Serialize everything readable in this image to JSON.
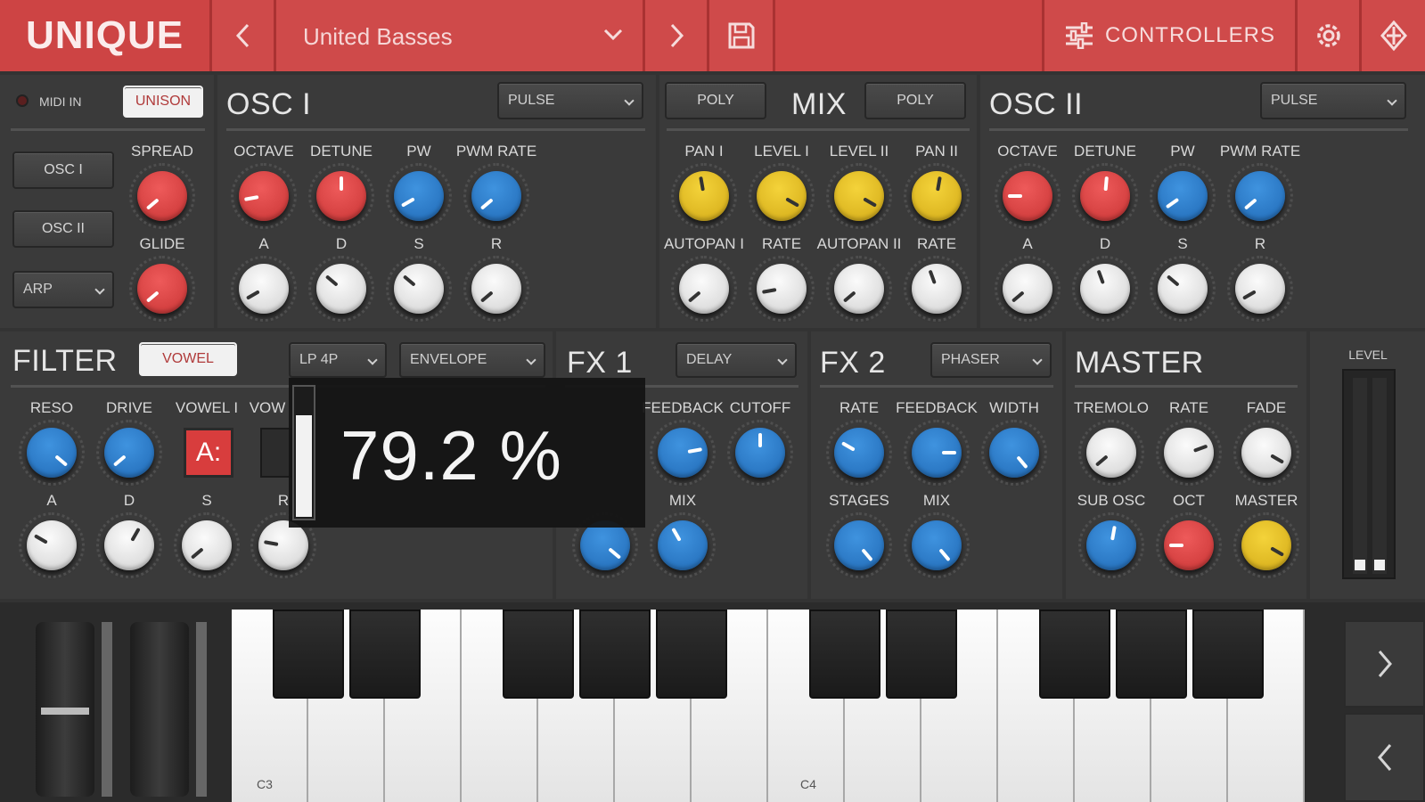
{
  "topbar": {
    "logo": "UNIQUE",
    "preset_name": "United Basses",
    "controllers_label": "CONTROLLERS"
  },
  "sidebar": {
    "midi_in": "MIDI IN",
    "unison": "UNISON",
    "osc1_button": "OSC I",
    "osc2_button": "OSC II",
    "arp_select": "ARP",
    "spread": "SPREAD",
    "glide": "GLIDE"
  },
  "osc1": {
    "title": "OSC I",
    "waveform": "PULSE",
    "labels": [
      "OCTAVE",
      "DETUNE",
      "PW",
      "PWM RATE",
      "A",
      "D",
      "S",
      "R"
    ]
  },
  "mix": {
    "title": "MIX",
    "poly_left": "POLY",
    "poly_right": "POLY",
    "labels": [
      "PAN I",
      "LEVEL I",
      "LEVEL II",
      "PAN II",
      "AUTOPAN I",
      "RATE",
      "AUTOPAN II",
      "RATE"
    ]
  },
  "osc2": {
    "title": "OSC II",
    "waveform": "PULSE",
    "labels": [
      "OCTAVE",
      "DETUNE",
      "PW",
      "PWM RATE",
      "A",
      "D",
      "S",
      "R"
    ]
  },
  "filter": {
    "title": "FILTER",
    "vowel_toggle": "VOWEL",
    "type": "LP 4P",
    "mod": "ENVELOPE",
    "labels": [
      "RESO",
      "DRIVE",
      "VOWEL I",
      "VOW",
      "A",
      "D",
      "S",
      "R"
    ],
    "vowel_value": "A:"
  },
  "fx1": {
    "title": "FX 1",
    "type": "DELAY",
    "labels": [
      "FEEDBACK",
      "CUTOFF",
      "MIX"
    ]
  },
  "fx2": {
    "title": "FX 2",
    "type": "PHASER",
    "labels": [
      "RATE",
      "FEEDBACK",
      "WIDTH",
      "STAGES",
      "MIX"
    ]
  },
  "master": {
    "title": "MASTER",
    "level": "LEVEL",
    "labels": [
      "TREMOLO",
      "RATE",
      "FADE",
      "SUB OSC",
      "OCT",
      "MASTER"
    ]
  },
  "overlay": {
    "value_text": "79.2 %",
    "fill": 0.792
  },
  "keyboard": {
    "label_c3": "C3",
    "label_c4": "C4"
  },
  "icons": [
    "chevron-left-icon",
    "chevron-down-icon",
    "chevron-right-icon",
    "save-icon",
    "sliders-icon",
    "gear-icon",
    "link-icon"
  ],
  "colors": {
    "accent_red": "#cf4a4a",
    "knob_red": "#d83d3d",
    "knob_blue": "#2a7ccb",
    "knob_yellow": "#e8bf25"
  }
}
